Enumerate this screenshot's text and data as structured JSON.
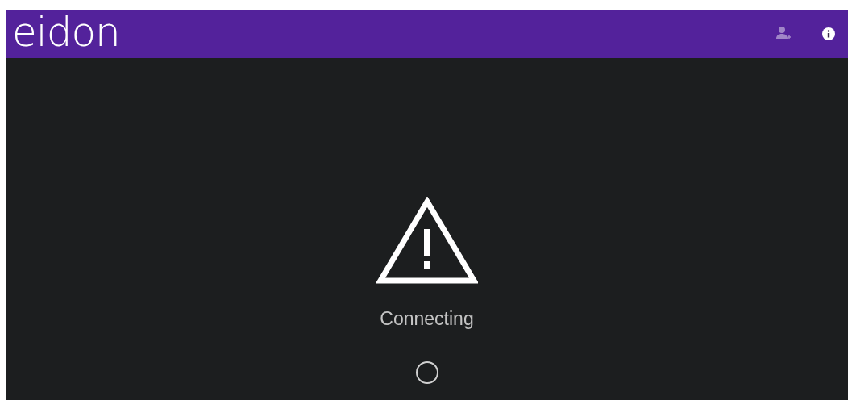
{
  "header": {
    "logo": "eidon",
    "actions": [
      {
        "kind": "add-user",
        "disabled": true
      },
      {
        "kind": "info",
        "disabled": false
      }
    ]
  },
  "status": {
    "message": "Connecting"
  }
}
